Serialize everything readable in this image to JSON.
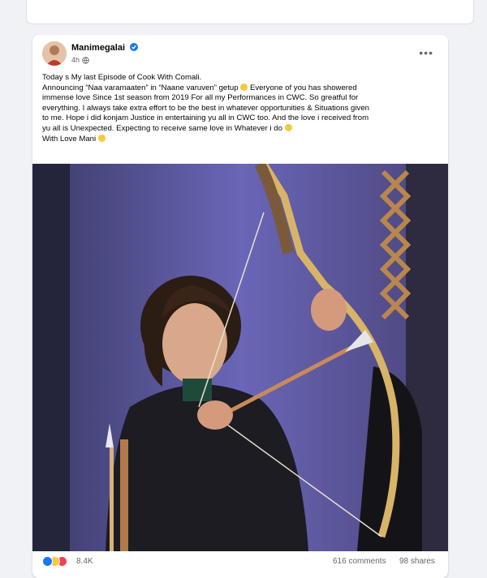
{
  "post": {
    "author": "Manimegalai",
    "time": "4h",
    "text_lines": [
      "Today s My last Episode of Cook With Comali.",
      "Announcing “Naa varamaaten” in “Naane varuven” getup",
      "Everyone of you has showered",
      "immense love Since 1st season from 2019 For all my Performances in CWC. So greatful for",
      "everything. I always take extra effort to be the best in whatever opportunities & Situations given",
      "to me. Hope i did konjam Justice in entertaining yu all in CWC too. And the love i received from",
      "yu all is Unexpected. Expecting to receive same love in Whatever i do",
      "With Love Mani"
    ],
    "reactions_count": "8.4K",
    "comments": "616 comments",
    "shares": "98 shares"
  },
  "icons": {
    "verified": "verified-badge-icon",
    "privacy": "globe-icon",
    "more": "more-options-icon"
  },
  "colors": {
    "accent": "#1877f2",
    "background": "#f0f2f5",
    "secondary_text": "#65676b"
  }
}
